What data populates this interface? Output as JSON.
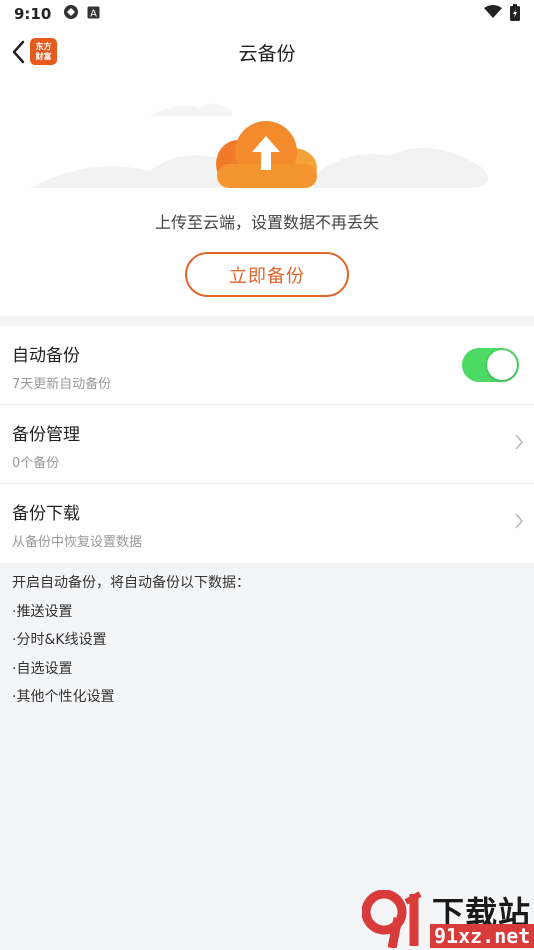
{
  "status_bar": {
    "time": "9:10"
  },
  "header": {
    "title": "云备份",
    "logo_text_line1": "东方",
    "logo_text_line2": "财富"
  },
  "hero": {
    "tagline": "上传至云端，设置数据不再丢失",
    "backup_button_label": "立即备份"
  },
  "settings": [
    {
      "title": "自动备份",
      "subtitle": "7天更新自动备份",
      "toggle_on": true
    },
    {
      "title": "备份管理",
      "subtitle": "0个备份"
    },
    {
      "title": "备份下载",
      "subtitle": "从备份中恢复设置数据"
    }
  ],
  "notes": {
    "intro": "开启自动备份，将自动备份以下数据：",
    "items": [
      "·推送设置",
      "·分时&K线设置",
      "·自选设置",
      "·其他个性化设置"
    ]
  },
  "watermark": {
    "top": "下载站",
    "bottom": "91xz.net"
  },
  "colors": {
    "accent": "#e0662c",
    "toggle_on": "#4cd964"
  }
}
